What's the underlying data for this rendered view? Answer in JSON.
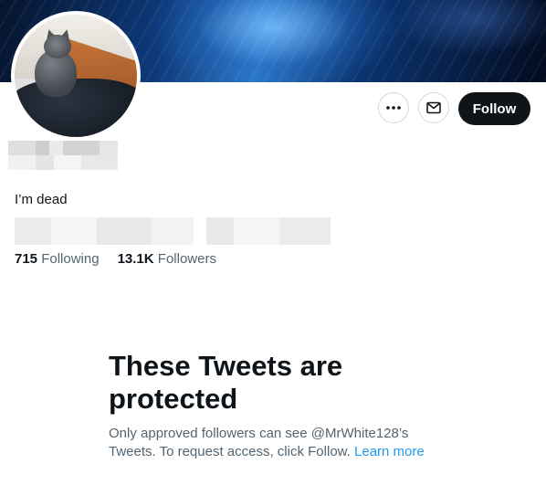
{
  "profile": {
    "bio": "I’m dead",
    "following_count": "715",
    "following_label": "Following",
    "followers_count": "13.1K",
    "followers_label": "Followers"
  },
  "actions": {
    "more_icon": "more-horizontal-icon",
    "message_icon": "envelope-icon",
    "follow_label": "Follow"
  },
  "protected_notice": {
    "title": "These Tweets are protected",
    "body": "Only approved followers can see @MrWhite128’s Tweets. To request access, click Follow.",
    "link": "Learn more"
  },
  "colors": {
    "follow_bg": "#0f1419",
    "link": "#1d9bf0",
    "secondary_text": "#536471"
  }
}
